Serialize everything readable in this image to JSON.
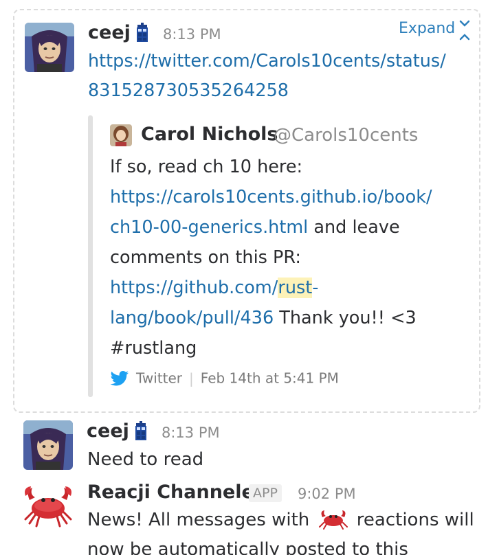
{
  "first_message": {
    "author": "ceej",
    "author_icon": "tardis-icon",
    "time": "8:13 PM",
    "link_line1": "https://twitter.com/Carols10cents/status/",
    "link_line2": "831528730535264258",
    "expand_label": "Expand"
  },
  "attachment": {
    "name": "Carol Nichols",
    "handle": "@Carols10cents",
    "text1": "If so, read ch 10 here:",
    "link1_line1": "https://carols10cents.github.io/book/",
    "link1_line2": "ch10-00-generics.html",
    "text2": " and leave",
    "text3": "comments on this PR:",
    "link2_a": "https://github.com/",
    "link2_hl": "rust",
    "link2_b": "-",
    "link2_line2": "lang/book/pull/436",
    "text4": " Thank you!! <3",
    "text5": "#rustlang",
    "service": "Twitter",
    "service_icon": "twitter-bird-icon",
    "date": "Feb 14th at 5:41 PM"
  },
  "second_message": {
    "author": "ceej",
    "time": "8:13 PM",
    "text": "Need to read"
  },
  "third_message": {
    "author": "Reacji Channeler",
    "badge": "APP",
    "time": "9:02 PM",
    "text_a": "News! All messages with",
    "emoji": "crab-emoji",
    "text_b": "reactions will",
    "text_c": "now be automatically posted to this"
  },
  "colors": {
    "link": "#1e6eaa",
    "expand": "#2d7fbb",
    "twitter": "#1da1f2",
    "highlight": "#fdf2b8"
  }
}
